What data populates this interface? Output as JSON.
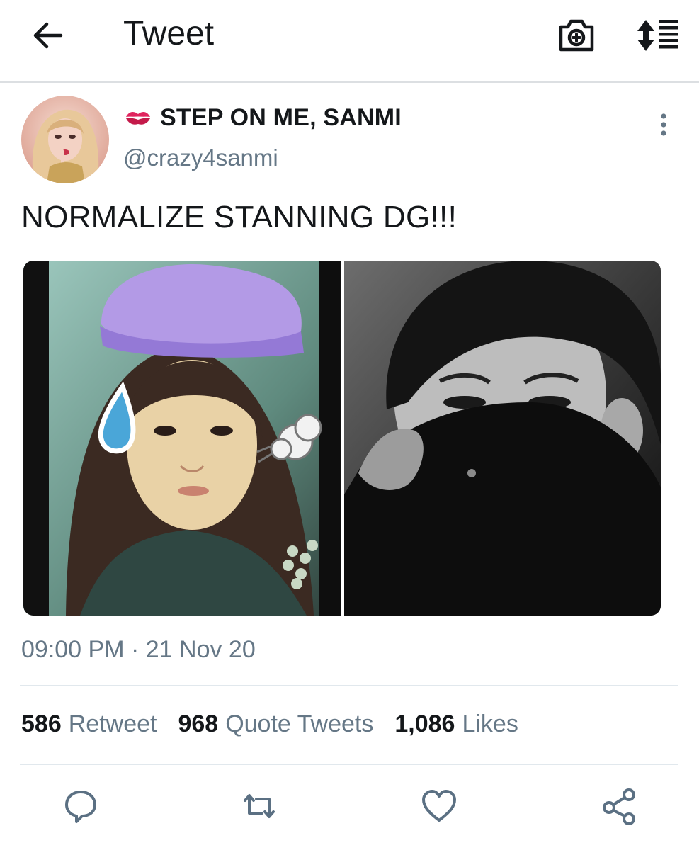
{
  "header": {
    "title": "Tweet",
    "back_icon": "arrow-left-icon",
    "camera_icon": "camera-plus-icon",
    "sort_icon": "sort-list-icon"
  },
  "tweet": {
    "display_name": "STEP ON ME, SANMI",
    "name_emoji_icon": "kiss-mark-icon",
    "handle": "@crazy4sanmi",
    "text": "NORMALIZE STANNING DG!!!",
    "timestamp": "09:00 PM · 21 Nov 20",
    "stats": [
      {
        "count": "586",
        "label": "Retweet"
      },
      {
        "count": "968",
        "label": "Quote Tweets"
      },
      {
        "count": "1,086",
        "label": "Likes"
      }
    ]
  },
  "actions": [
    "reply-icon",
    "retweet-icon",
    "like-icon",
    "share-icon"
  ],
  "colors": {
    "text": "#14171a",
    "secondary": "#657786",
    "action_icon": "#5b7083",
    "divider": "#e1e8ed"
  }
}
